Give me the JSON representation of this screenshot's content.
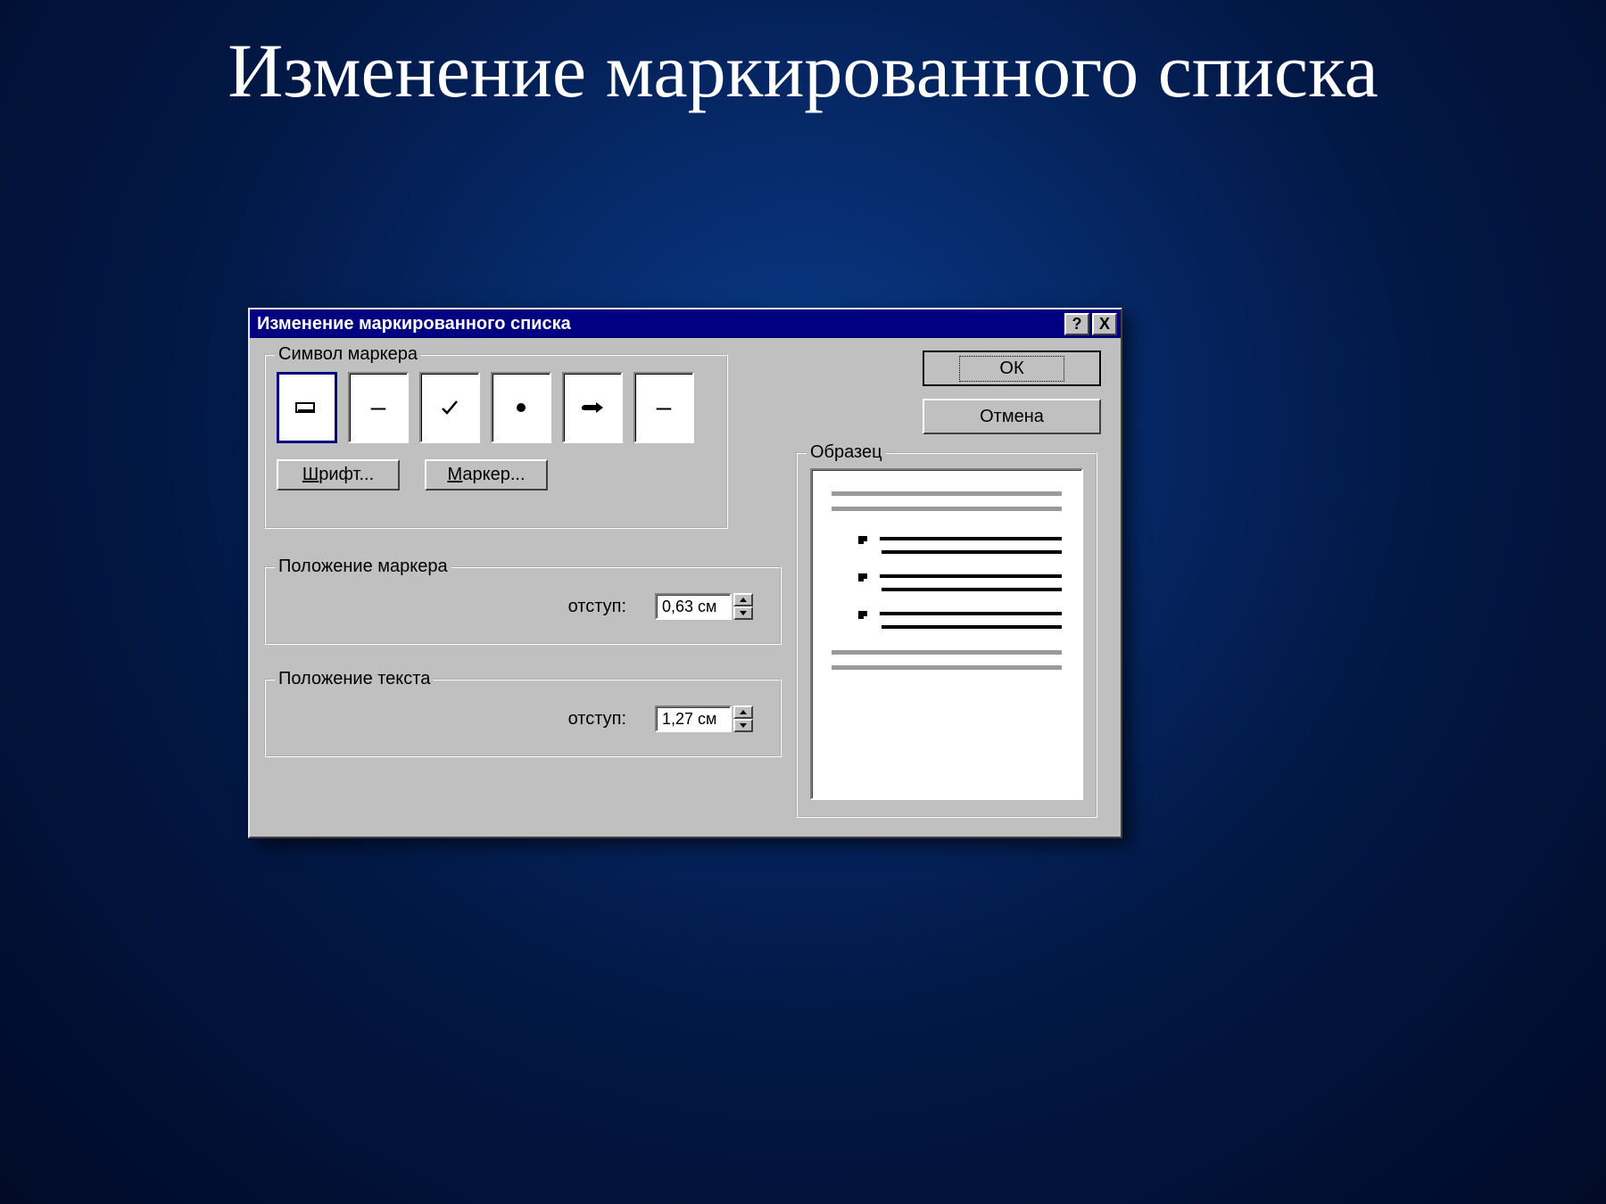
{
  "slide": {
    "title": "Изменение маркированного списка"
  },
  "dialog": {
    "title": "Изменение маркированного списка",
    "helpBtn": "?",
    "closeBtn": "X",
    "buttons": {
      "ok": "ОК",
      "cancel": "Отмена"
    },
    "groups": {
      "bulletSymbol": "Символ маркера",
      "bulletPosition": "Положение маркера",
      "textPosition": "Положение текста",
      "preview": "Образец"
    },
    "fontBtn": "Шрифт...",
    "bulletBtn": "Маркер...",
    "indentLabel": "отступ:",
    "bulletIndent": "0,63 см",
    "textIndent": "1,27 см",
    "bullets": [
      "▭",
      "–",
      "✓",
      "●",
      "☞",
      "–"
    ]
  }
}
